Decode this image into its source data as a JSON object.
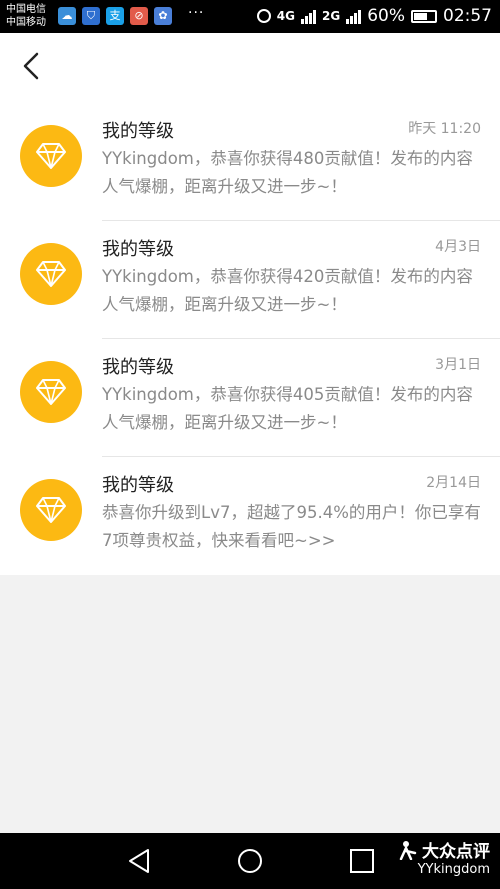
{
  "status_bar": {
    "carrier_1": "中国电信",
    "carrier_2": "中国移动",
    "app_icons": [
      "cloud-icon",
      "shield-icon",
      "alipay-icon",
      "stop-icon",
      "app-icon"
    ],
    "more": "···",
    "net_1": "4G",
    "net_2": "2G",
    "battery": "60%",
    "time": "02:57"
  },
  "header": {
    "back_icon": "chevron-left-icon"
  },
  "messages": [
    {
      "title": "我的等级",
      "time": "昨天 11:20",
      "body": "YYkingdom，恭喜你获得480贡献值！发布的内容人气爆棚，距离升级又进一步~！"
    },
    {
      "title": "我的等级",
      "time": "4月3日",
      "body": "YYkingdom，恭喜你获得420贡献值！发布的内容人气爆棚，距离升级又进一步~！"
    },
    {
      "title": "我的等级",
      "time": "3月1日",
      "body": "YYkingdom，恭喜你获得405贡献值！发布的内容人气爆棚，距离升级又进一步~！"
    },
    {
      "title": "我的等级",
      "time": "2月14日",
      "body": "恭喜你升级到Lv7，超越了95.4%的用户！你已享有7项尊贵权益，快来看看吧~>>"
    }
  ],
  "watermark": {
    "brand": "大众点评",
    "user": "YYkingdom"
  },
  "colors": {
    "accent": "#fcb913",
    "status_bar": "#000000",
    "background": "#f2f2f2"
  }
}
